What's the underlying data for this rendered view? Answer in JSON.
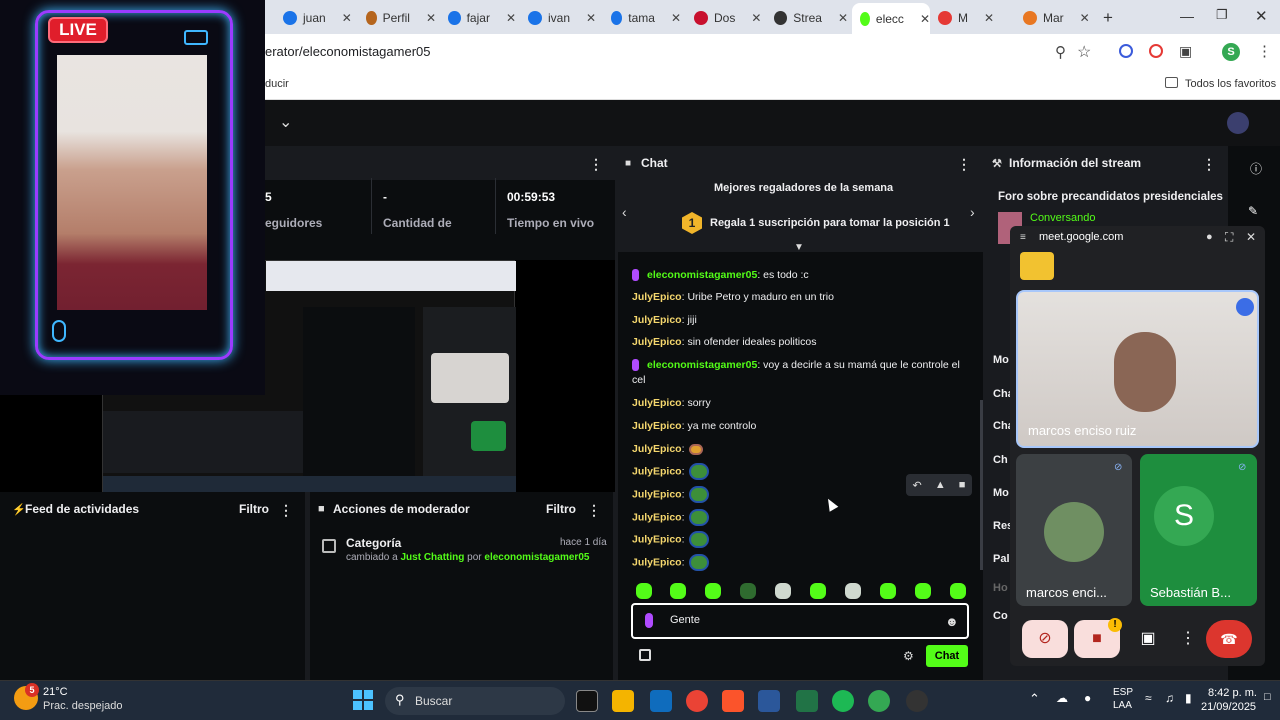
{
  "browser": {
    "tabs": [
      {
        "label": "juan",
        "color": "#1a73e8"
      },
      {
        "label": "Perfil",
        "color": "#b5651d"
      },
      {
        "label": "fajar",
        "color": "#1a73e8"
      },
      {
        "label": "ivan",
        "color": "#1a73e8"
      },
      {
        "label": "tama",
        "color": "#1a73e8"
      },
      {
        "label": "Dos",
        "color": "#c8102e"
      },
      {
        "label": "Strea",
        "color": "#333333"
      },
      {
        "label": "elecc",
        "color": "#53fc18"
      },
      {
        "label": "M",
        "color": "#e53935"
      },
      {
        "label": "Mar",
        "color": "#e87722"
      }
    ],
    "url": "erator/eleconomistagamer05",
    "bookmark_left": "ducir",
    "bookmark_right": "Todos los favoritos",
    "profile_initial": "S"
  },
  "stats": [
    {
      "value": "5",
      "label": "eguidores"
    },
    {
      "value": "-",
      "label": "Cantidad de"
    },
    {
      "value": "00:59:53",
      "label": "Tiempo en vivo"
    }
  ],
  "chat": {
    "title": "Chat",
    "gifters_title": "Mejores regaladores de la semana",
    "gifters_rank": "1",
    "gifters_text": "Regala 1 suscripción para tomar la posición 1",
    "messages": [
      {
        "user": "eleconomistagamer05",
        "text": ": es todo :c"
      },
      {
        "user": "JulyEpico",
        "text": ": Uribe Petro y maduro en un trio"
      },
      {
        "user": "JulyEpico",
        "text": ": jiji"
      },
      {
        "user": "JulyEpico",
        "text": ": sin ofender ideales politicos"
      },
      {
        "user": "eleconomistagamer05",
        "text": ": voy a decirle a su mamá que le controle el cel"
      },
      {
        "user": "JulyEpico",
        "text": ": sorry"
      },
      {
        "user": "JulyEpico",
        "text": ": ya me controlo"
      },
      {
        "user": "JulyEpico",
        "text": ":"
      },
      {
        "user": "JulyEpico",
        "text": ":"
      },
      {
        "user": "JulyEpico",
        "text": ":"
      },
      {
        "user": "JulyEpico",
        "text": ":"
      },
      {
        "user": "JulyEpico",
        "text": ":"
      },
      {
        "user": "JulyEpico",
        "text": ":"
      }
    ],
    "input_value": "Gente",
    "send_label": "Chat"
  },
  "stream_info": {
    "title": "Información del stream",
    "stream_title": "Foro sobre precandidatos presidenciales",
    "category": "Conversando",
    "side_labels": [
      "Mo",
      "Cha",
      "Cha",
      "Ch",
      "Mo",
      "Res",
      "Pal",
      "Ho",
      "Co"
    ]
  },
  "activity_feed": {
    "title": "Feed de actividades",
    "filter": "Filtro"
  },
  "mod_actions": {
    "title": "Acciones de moderador",
    "filter": "Filtro",
    "item_title": "Categoría",
    "item_time": "hace 1 día",
    "item_text_1": "cambiado a",
    "item_category": "Just Chatting",
    "item_text_2": "por",
    "item_user": "eleconomistagamer05"
  },
  "meet": {
    "domain": "meet.google.com",
    "main_name": "marcos enciso ruiz",
    "tile1_name": "marcos enci...",
    "tile2_name": "Sebastián B...",
    "tile2_initial": "S"
  },
  "overlay": {
    "live": "LIVE"
  },
  "taskbar": {
    "weather_temp": "21°C",
    "weather_desc": "Prac. despejado",
    "weather_badge": "5",
    "search": "Buscar",
    "lang_1": "ESP",
    "lang_2": "LAA",
    "time": "8:42 p. m.",
    "date": "21/09/2025"
  },
  "colors": {
    "kick_green": "#53fc18",
    "live_red": "#e01e2b",
    "neon_purple": "#9b3cff",
    "neon_blue": "#3fb7ff"
  }
}
